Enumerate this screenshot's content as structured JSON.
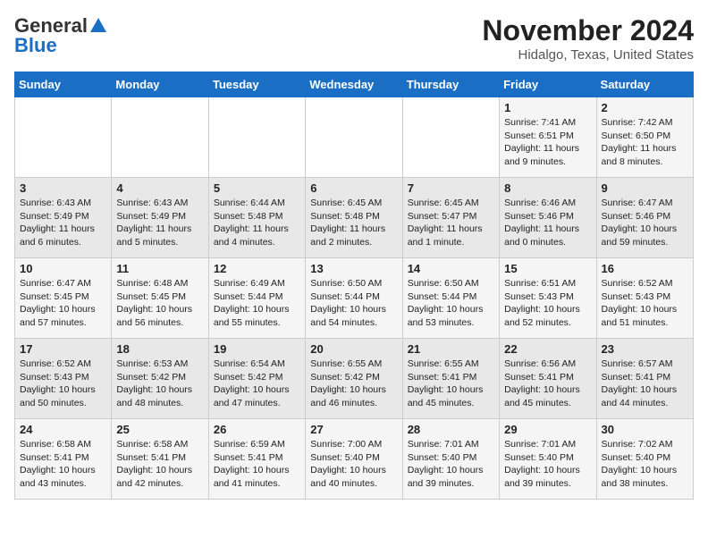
{
  "header": {
    "logo_general": "General",
    "logo_blue": "Blue",
    "month_title": "November 2024",
    "location": "Hidalgo, Texas, United States"
  },
  "days_of_week": [
    "Sunday",
    "Monday",
    "Tuesday",
    "Wednesday",
    "Thursday",
    "Friday",
    "Saturday"
  ],
  "weeks": [
    [
      {
        "day": "",
        "info": ""
      },
      {
        "day": "",
        "info": ""
      },
      {
        "day": "",
        "info": ""
      },
      {
        "day": "",
        "info": ""
      },
      {
        "day": "",
        "info": ""
      },
      {
        "day": "1",
        "info": "Sunrise: 7:41 AM\nSunset: 6:51 PM\nDaylight: 11 hours and 9 minutes."
      },
      {
        "day": "2",
        "info": "Sunrise: 7:42 AM\nSunset: 6:50 PM\nDaylight: 11 hours and 8 minutes."
      }
    ],
    [
      {
        "day": "3",
        "info": "Sunrise: 6:43 AM\nSunset: 5:49 PM\nDaylight: 11 hours and 6 minutes."
      },
      {
        "day": "4",
        "info": "Sunrise: 6:43 AM\nSunset: 5:49 PM\nDaylight: 11 hours and 5 minutes."
      },
      {
        "day": "5",
        "info": "Sunrise: 6:44 AM\nSunset: 5:48 PM\nDaylight: 11 hours and 4 minutes."
      },
      {
        "day": "6",
        "info": "Sunrise: 6:45 AM\nSunset: 5:48 PM\nDaylight: 11 hours and 2 minutes."
      },
      {
        "day": "7",
        "info": "Sunrise: 6:45 AM\nSunset: 5:47 PM\nDaylight: 11 hours and 1 minute."
      },
      {
        "day": "8",
        "info": "Sunrise: 6:46 AM\nSunset: 5:46 PM\nDaylight: 11 hours and 0 minutes."
      },
      {
        "day": "9",
        "info": "Sunrise: 6:47 AM\nSunset: 5:46 PM\nDaylight: 10 hours and 59 minutes."
      }
    ],
    [
      {
        "day": "10",
        "info": "Sunrise: 6:47 AM\nSunset: 5:45 PM\nDaylight: 10 hours and 57 minutes."
      },
      {
        "day": "11",
        "info": "Sunrise: 6:48 AM\nSunset: 5:45 PM\nDaylight: 10 hours and 56 minutes."
      },
      {
        "day": "12",
        "info": "Sunrise: 6:49 AM\nSunset: 5:44 PM\nDaylight: 10 hours and 55 minutes."
      },
      {
        "day": "13",
        "info": "Sunrise: 6:50 AM\nSunset: 5:44 PM\nDaylight: 10 hours and 54 minutes."
      },
      {
        "day": "14",
        "info": "Sunrise: 6:50 AM\nSunset: 5:44 PM\nDaylight: 10 hours and 53 minutes."
      },
      {
        "day": "15",
        "info": "Sunrise: 6:51 AM\nSunset: 5:43 PM\nDaylight: 10 hours and 52 minutes."
      },
      {
        "day": "16",
        "info": "Sunrise: 6:52 AM\nSunset: 5:43 PM\nDaylight: 10 hours and 51 minutes."
      }
    ],
    [
      {
        "day": "17",
        "info": "Sunrise: 6:52 AM\nSunset: 5:43 PM\nDaylight: 10 hours and 50 minutes."
      },
      {
        "day": "18",
        "info": "Sunrise: 6:53 AM\nSunset: 5:42 PM\nDaylight: 10 hours and 48 minutes."
      },
      {
        "day": "19",
        "info": "Sunrise: 6:54 AM\nSunset: 5:42 PM\nDaylight: 10 hours and 47 minutes."
      },
      {
        "day": "20",
        "info": "Sunrise: 6:55 AM\nSunset: 5:42 PM\nDaylight: 10 hours and 46 minutes."
      },
      {
        "day": "21",
        "info": "Sunrise: 6:55 AM\nSunset: 5:41 PM\nDaylight: 10 hours and 45 minutes."
      },
      {
        "day": "22",
        "info": "Sunrise: 6:56 AM\nSunset: 5:41 PM\nDaylight: 10 hours and 45 minutes."
      },
      {
        "day": "23",
        "info": "Sunrise: 6:57 AM\nSunset: 5:41 PM\nDaylight: 10 hours and 44 minutes."
      }
    ],
    [
      {
        "day": "24",
        "info": "Sunrise: 6:58 AM\nSunset: 5:41 PM\nDaylight: 10 hours and 43 minutes."
      },
      {
        "day": "25",
        "info": "Sunrise: 6:58 AM\nSunset: 5:41 PM\nDaylight: 10 hours and 42 minutes."
      },
      {
        "day": "26",
        "info": "Sunrise: 6:59 AM\nSunset: 5:41 PM\nDaylight: 10 hours and 41 minutes."
      },
      {
        "day": "27",
        "info": "Sunrise: 7:00 AM\nSunset: 5:40 PM\nDaylight: 10 hours and 40 minutes."
      },
      {
        "day": "28",
        "info": "Sunrise: 7:01 AM\nSunset: 5:40 PM\nDaylight: 10 hours and 39 minutes."
      },
      {
        "day": "29",
        "info": "Sunrise: 7:01 AM\nSunset: 5:40 PM\nDaylight: 10 hours and 39 minutes."
      },
      {
        "day": "30",
        "info": "Sunrise: 7:02 AM\nSunset: 5:40 PM\nDaylight: 10 hours and 38 minutes."
      }
    ]
  ]
}
